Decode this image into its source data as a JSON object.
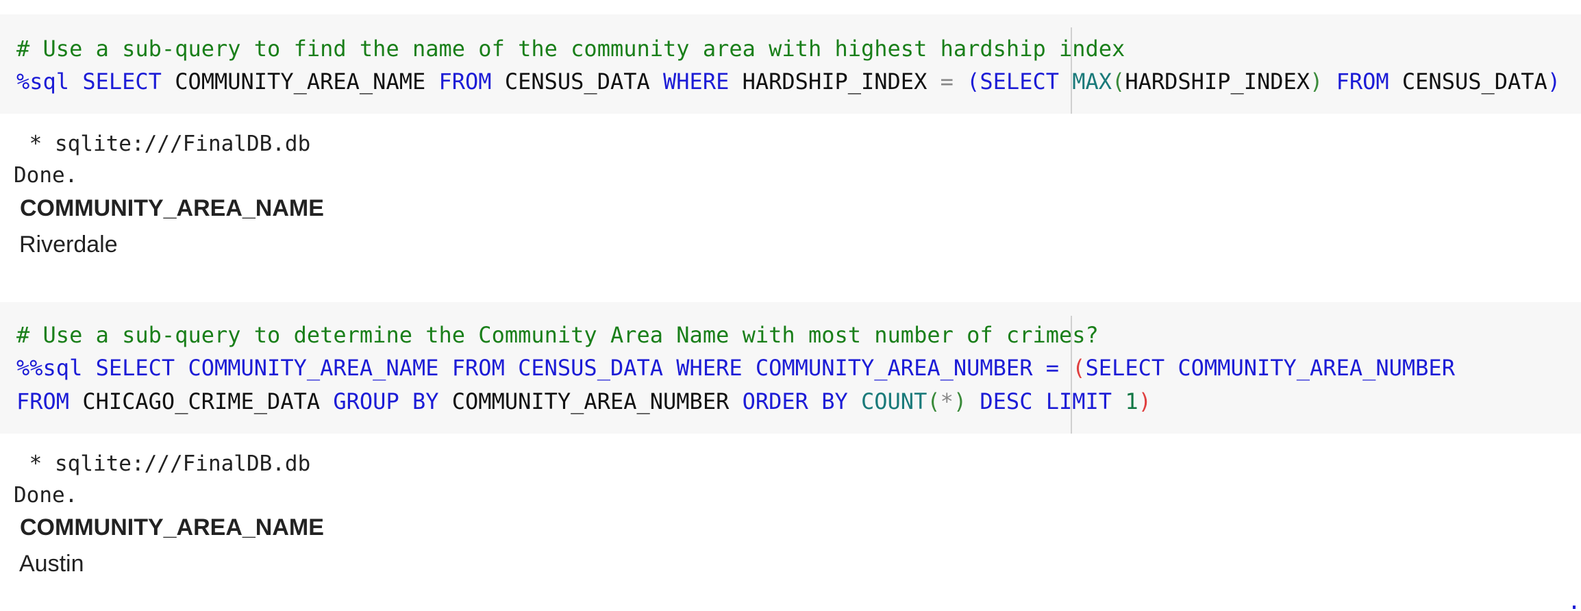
{
  "cells": [
    {
      "input_lines": [
        [
          {
            "t": "comment",
            "v": "# Use a sub-query to find the name of the community area with highest hardship index"
          }
        ],
        [
          {
            "t": "magic",
            "v": "%sql"
          },
          {
            "t": "name",
            "v": " "
          },
          {
            "t": "keyword",
            "v": "SELECT"
          },
          {
            "t": "name",
            "v": " COMMUNITY_AREA_NAME "
          },
          {
            "t": "keyword",
            "v": "FROM"
          },
          {
            "t": "name",
            "v": " CENSUS_DATA "
          },
          {
            "t": "keyword",
            "v": "WHERE"
          },
          {
            "t": "name",
            "v": " HARDSHIP_INDEX "
          },
          {
            "t": "op",
            "v": "="
          },
          {
            "t": "name",
            "v": " "
          },
          {
            "t": "paren-blue",
            "v": "("
          },
          {
            "t": "keyword",
            "v": "SELECT"
          },
          {
            "t": "name",
            "v": " "
          },
          {
            "t": "func",
            "v": "MAX"
          },
          {
            "t": "paren-green",
            "v": "("
          },
          {
            "t": "name",
            "v": "HARDSHIP_INDEX"
          },
          {
            "t": "paren-green",
            "v": ")"
          },
          {
            "t": "name",
            "v": " "
          },
          {
            "t": "keyword",
            "v": "FROM"
          },
          {
            "t": "name",
            "v": " CENSUS_DATA"
          },
          {
            "t": "paren-blue",
            "v": ")"
          }
        ]
      ],
      "output": {
        "connection": " * sqlite:///FinalDB.db",
        "status": "Done.",
        "column_header": "COMMUNITY_AREA_NAME",
        "rows": [
          "Riverdale"
        ]
      }
    },
    {
      "input_lines": [
        [
          {
            "t": "comment",
            "v": "# Use a sub-query to determine the Community Area Name with most number of crimes?"
          }
        ],
        [
          {
            "t": "magic",
            "v": "%%sql"
          },
          {
            "t": "name",
            "v": " "
          },
          {
            "t": "keyword",
            "v": "SELECT COMMUNITY_AREA_NAME FROM CENSUS_DATA WHERE COMMUNITY_AREA_NUMBER = "
          },
          {
            "t": "paren-red",
            "v": "("
          },
          {
            "t": "keyword",
            "v": "SELECT COMMUNITY_AREA_NUMBER"
          }
        ],
        [
          {
            "t": "keyword",
            "v": "FROM"
          },
          {
            "t": "name",
            "v": " CHICAGO_CRIME_DATA "
          },
          {
            "t": "keyword",
            "v": "GROUP BY"
          },
          {
            "t": "name",
            "v": " COMMUNITY_AREA_NUMBER "
          },
          {
            "t": "keyword",
            "v": "ORDER BY"
          },
          {
            "t": "name",
            "v": " "
          },
          {
            "t": "func",
            "v": "COUNT"
          },
          {
            "t": "paren-green",
            "v": "("
          },
          {
            "t": "op",
            "v": "*"
          },
          {
            "t": "paren-green",
            "v": ")"
          },
          {
            "t": "name",
            "v": " "
          },
          {
            "t": "keyword",
            "v": "DESC LIMIT"
          },
          {
            "t": "name",
            "v": " "
          },
          {
            "t": "number",
            "v": "1"
          },
          {
            "t": "paren-red",
            "v": ")"
          }
        ]
      ],
      "output": {
        "connection": " * sqlite:///FinalDB.db",
        "status": "Done.",
        "column_header": "COMMUNITY_AREA_NAME",
        "rows": [
          "Austin"
        ]
      }
    }
  ]
}
